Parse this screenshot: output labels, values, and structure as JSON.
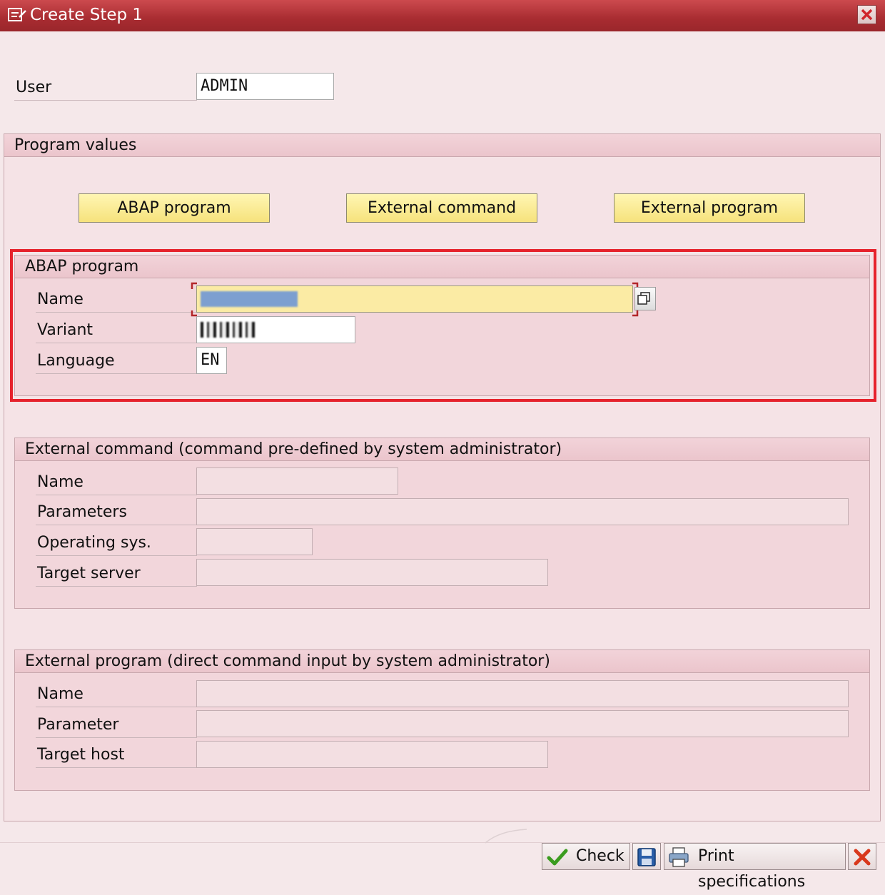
{
  "window": {
    "title": "Create Step  1"
  },
  "user": {
    "label": "User",
    "value": "ADMIN"
  },
  "program_values": {
    "title": "Program values",
    "buttons": [
      "ABAP program",
      "External command",
      "External program"
    ]
  },
  "abap_program": {
    "title": "ABAP program",
    "name_label": "Name",
    "name_value": "",
    "variant_label": "Variant",
    "variant_value": "",
    "language_label": "Language",
    "language_value": "EN"
  },
  "external_command": {
    "title": "External command (command pre-defined by system administrator)",
    "name_label": "Name",
    "parameters_label": "Parameters",
    "os_label": "Operating sys.",
    "target_server_label": "Target server"
  },
  "external_program": {
    "title": "External program (direct command input by system administrator)",
    "name_label": "Name",
    "parameter_label": "Parameter",
    "target_host_label": "Target host"
  },
  "footer": {
    "check_label": "Check",
    "print_label": "Print specifications"
  },
  "colors": {
    "titlebar": "#a82c31",
    "background": "#f5e8ea",
    "group": "#f2d6db",
    "button_yellow": "#f6e27c",
    "highlight_red": "#e6222c"
  }
}
